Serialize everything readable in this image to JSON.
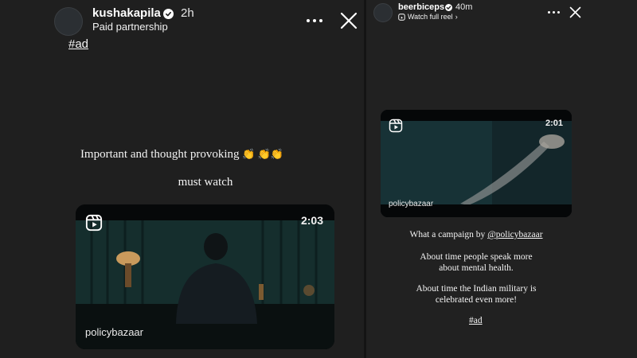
{
  "left_story": {
    "username": "kushakapila",
    "time": "2h",
    "subtitle": "Paid partnership",
    "hashtag": "#ad",
    "caption_line1": "Important and thought provoking",
    "caption_emoji": "👏 👏👏",
    "caption_line2": "must watch",
    "video": {
      "duration": "2:03",
      "brand": "policybazaar"
    }
  },
  "right_story": {
    "username": "beerbiceps",
    "time": "40m",
    "watch_full_reel": "Watch full reel",
    "video": {
      "duration": "2:01",
      "brand": "policybazaar"
    },
    "caption_prefix": "What a campaign by ",
    "mention": "@policybazaar",
    "para2_line1": "About time people speak more",
    "para2_line2": "about mental health.",
    "para3_line1": "About time the Indian military is",
    "para3_line2": "celebrated even more!",
    "hashtag": "#ad"
  },
  "icons": {
    "more": "more-options-icon",
    "close": "close-icon",
    "verified": "verified-badge-icon",
    "reel": "reels-icon"
  }
}
